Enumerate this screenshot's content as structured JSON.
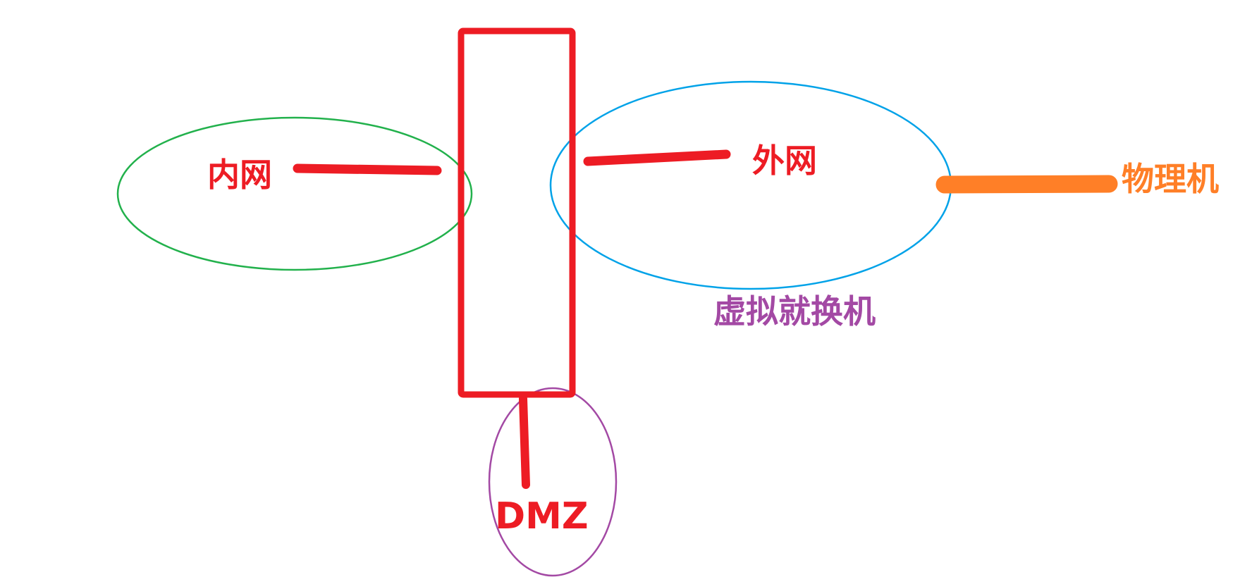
{
  "labels": {
    "internal_network": "内网",
    "external_network": "外网",
    "physical_machine": "物理机",
    "virtual_switch": "虚拟就换机",
    "dmz": "DMZ"
  },
  "colors": {
    "firewall_box": "#ED1C24",
    "internal_ellipse": "#22B14C",
    "external_ellipse": "#00A2E8",
    "dmz_ellipse": "#A349A4",
    "physical_link": "#FF7F27",
    "internal_label": "#ED1C24",
    "external_label": "#ED1C24",
    "dmz_label": "#ED1C24",
    "physical_label": "#FF7F27",
    "virtual_switch_label": "#A349A4"
  }
}
